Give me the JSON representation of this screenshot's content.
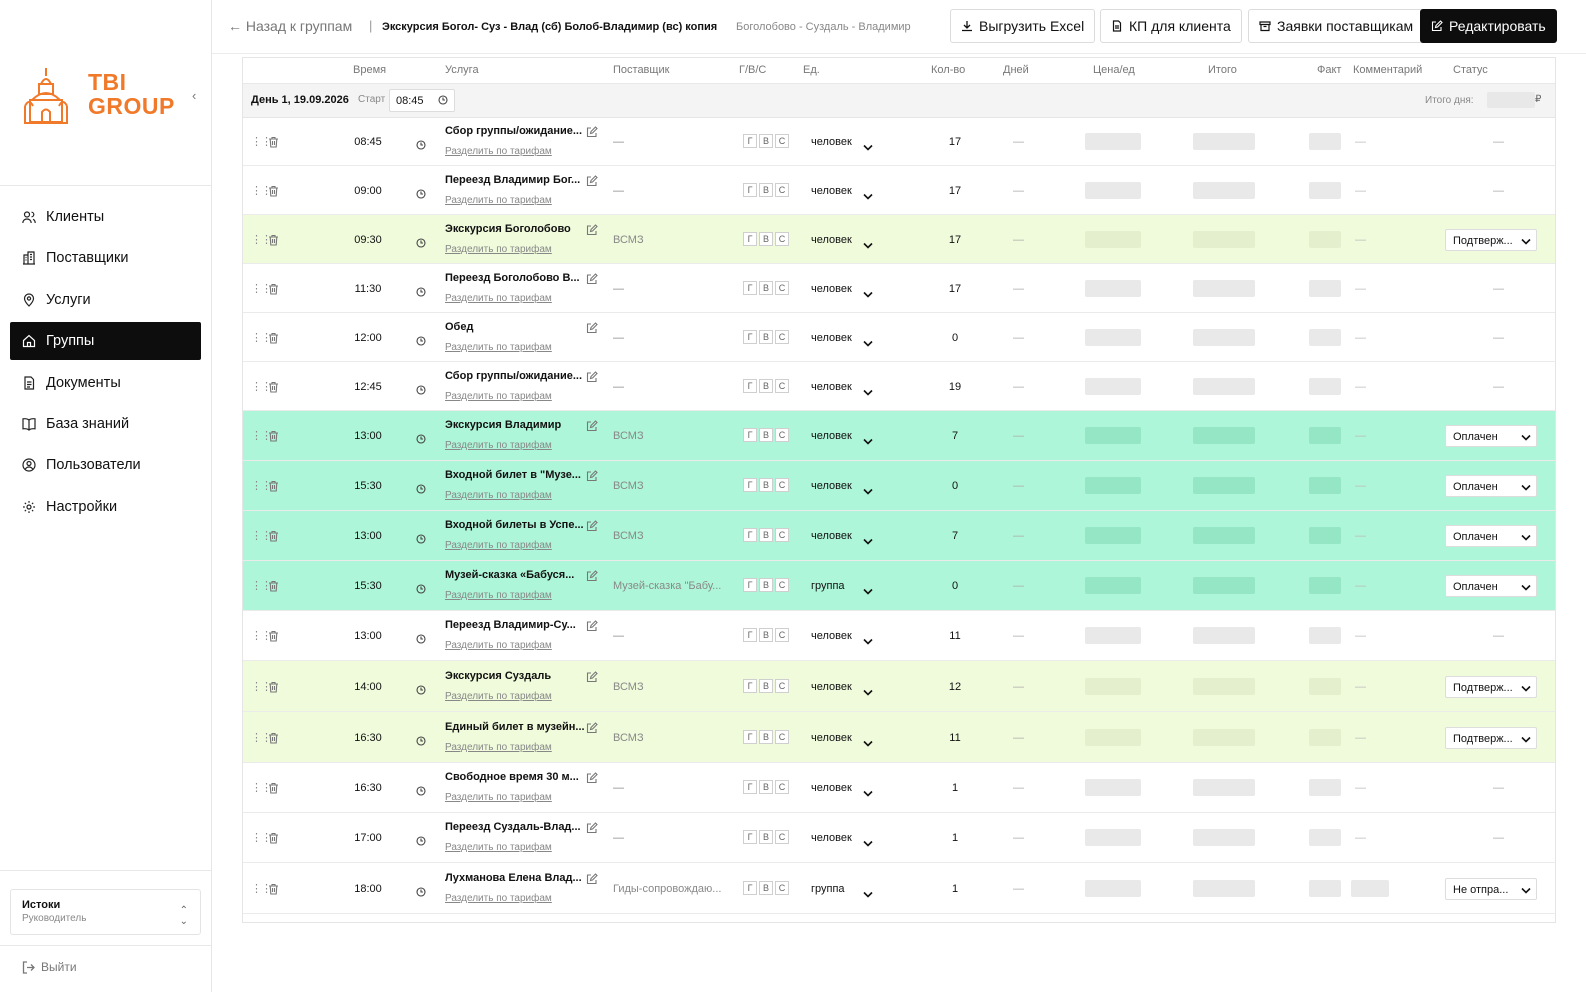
{
  "brand": {
    "logo_line1": "TBI",
    "logo_line2": "GROUP",
    "accent": "#f07a2a"
  },
  "sidebar": {
    "items": [
      {
        "label": "Клиенты",
        "icon": "users-icon",
        "active": false
      },
      {
        "label": "Поставщики",
        "icon": "building-icon",
        "active": false
      },
      {
        "label": "Услуги",
        "icon": "location-pin-icon",
        "active": false
      },
      {
        "label": "Группы",
        "icon": "home-icon",
        "active": true
      },
      {
        "label": "Документы",
        "icon": "document-icon",
        "active": false
      },
      {
        "label": "База знаний",
        "icon": "book-icon",
        "active": false
      },
      {
        "label": "Пользователи",
        "icon": "user-circle-icon",
        "active": false
      },
      {
        "label": "Настройки",
        "icon": "gear-icon",
        "active": false
      }
    ],
    "user": {
      "name": "Истоки",
      "role": "Руководитель"
    },
    "logout": "Выйти"
  },
  "topbar": {
    "back": "Назад к группам",
    "separator": "|",
    "group_title": "Экскурсия Богол- Суз - Влад (сб) Болоб-Владимир (вс) копия",
    "route": "Боголобово - Суздаль - Владимир",
    "buttons": {
      "excel": "Выгрузить Excel",
      "kp": "КП для клиента",
      "requests": "Заявки поставщикам",
      "edit": "Редактировать"
    }
  },
  "table": {
    "headers": {
      "time": "Время",
      "service": "Услуга",
      "supplier": "Поставщик",
      "gvs": "Г/В/С",
      "unit": "Ед.",
      "qty": "Кол-во",
      "days": "Дней",
      "price": "Цена/ед",
      "total": "Итого",
      "fact": "Факт",
      "comment": "Комментарий",
      "status": "Статус"
    },
    "day": {
      "label": "День 1, 19.09.2026",
      "start_label": "Старт",
      "start_time": "08:45",
      "total_label": "Итого дня:",
      "currency": "₽"
    },
    "split_label": "Разделить по тарифам",
    "gvs_letters": [
      "Г",
      "В",
      "С"
    ],
    "dash": "—",
    "rows": [
      {
        "time": "08:45",
        "service": "Сбор группы/ожидание...",
        "supplier": "—",
        "unit": "человек",
        "qty": "17",
        "status": "",
        "state": "plain"
      },
      {
        "time": "09:00",
        "service": "Переезд Владимир Бог...",
        "supplier": "—",
        "unit": "человек",
        "qty": "17",
        "status": "",
        "state": "plain"
      },
      {
        "time": "09:30",
        "service": "Экскурсия Боголобово",
        "supplier": "ВСМЗ",
        "unit": "человек",
        "qty": "17",
        "status": "Подтверж...",
        "state": "confirm"
      },
      {
        "time": "11:30",
        "service": "Переезд Боголобово В...",
        "supplier": "—",
        "unit": "человек",
        "qty": "17",
        "status": "",
        "state": "plain"
      },
      {
        "time": "12:00",
        "service": "Обед",
        "supplier": "—",
        "unit": "человек",
        "qty": "0",
        "status": "",
        "state": "plain"
      },
      {
        "time": "12:45",
        "service": "Сбор группы/ожидание...",
        "supplier": "—",
        "unit": "человек",
        "qty": "19",
        "status": "",
        "state": "plain"
      },
      {
        "time": "13:00",
        "service": "Экскурсия Владимир",
        "supplier": "ВСМЗ",
        "unit": "человек",
        "qty": "7",
        "status": "Оплачен",
        "state": "paid"
      },
      {
        "time": "15:30",
        "service": "Входной билет в \"Музе...",
        "supplier": "ВСМЗ",
        "unit": "человек",
        "qty": "0",
        "status": "Оплачен",
        "state": "paid"
      },
      {
        "time": "13:00",
        "service": "Входной билеты в Успе...",
        "supplier": "ВСМЗ",
        "unit": "человек",
        "qty": "7",
        "status": "Оплачен",
        "state": "paid"
      },
      {
        "time": "15:30",
        "service": "Музей-сказка «Бабуся...",
        "supplier": "Музей-сказка \"Бабу...",
        "unit": "группа",
        "qty": "0",
        "status": "Оплачен",
        "state": "paid"
      },
      {
        "time": "13:00",
        "service": "Переезд Владимир-Су...",
        "supplier": "—",
        "unit": "человек",
        "qty": "11",
        "status": "",
        "state": "plain"
      },
      {
        "time": "14:00",
        "service": "Экскурсия Суздаль",
        "supplier": "ВСМЗ",
        "unit": "человек",
        "qty": "12",
        "status": "Подтверж...",
        "state": "confirm"
      },
      {
        "time": "16:30",
        "service": "Единый билет в музейн...",
        "supplier": "ВСМЗ",
        "unit": "человек",
        "qty": "11",
        "status": "Подтверж...",
        "state": "confirm"
      },
      {
        "time": "16:30",
        "service": "Свободное время 30 м...",
        "supplier": "—",
        "unit": "человек",
        "qty": "1",
        "status": "",
        "state": "plain"
      },
      {
        "time": "17:00",
        "service": "Переезд Суздаль-Влад...",
        "supplier": "—",
        "unit": "человек",
        "qty": "1",
        "status": "",
        "state": "plain"
      },
      {
        "time": "18:00",
        "service": "Лухманова Елена Влад...",
        "supplier": "Гиды-сопровождаю...",
        "unit": "группа",
        "qty": "1",
        "status": "Не отпра...",
        "state": "plain",
        "has_comment": true
      }
    ]
  },
  "colors": {
    "paid": "#aef6d9",
    "confirm": "#f0fbdc",
    "active_nav": "#0d0d0d"
  }
}
